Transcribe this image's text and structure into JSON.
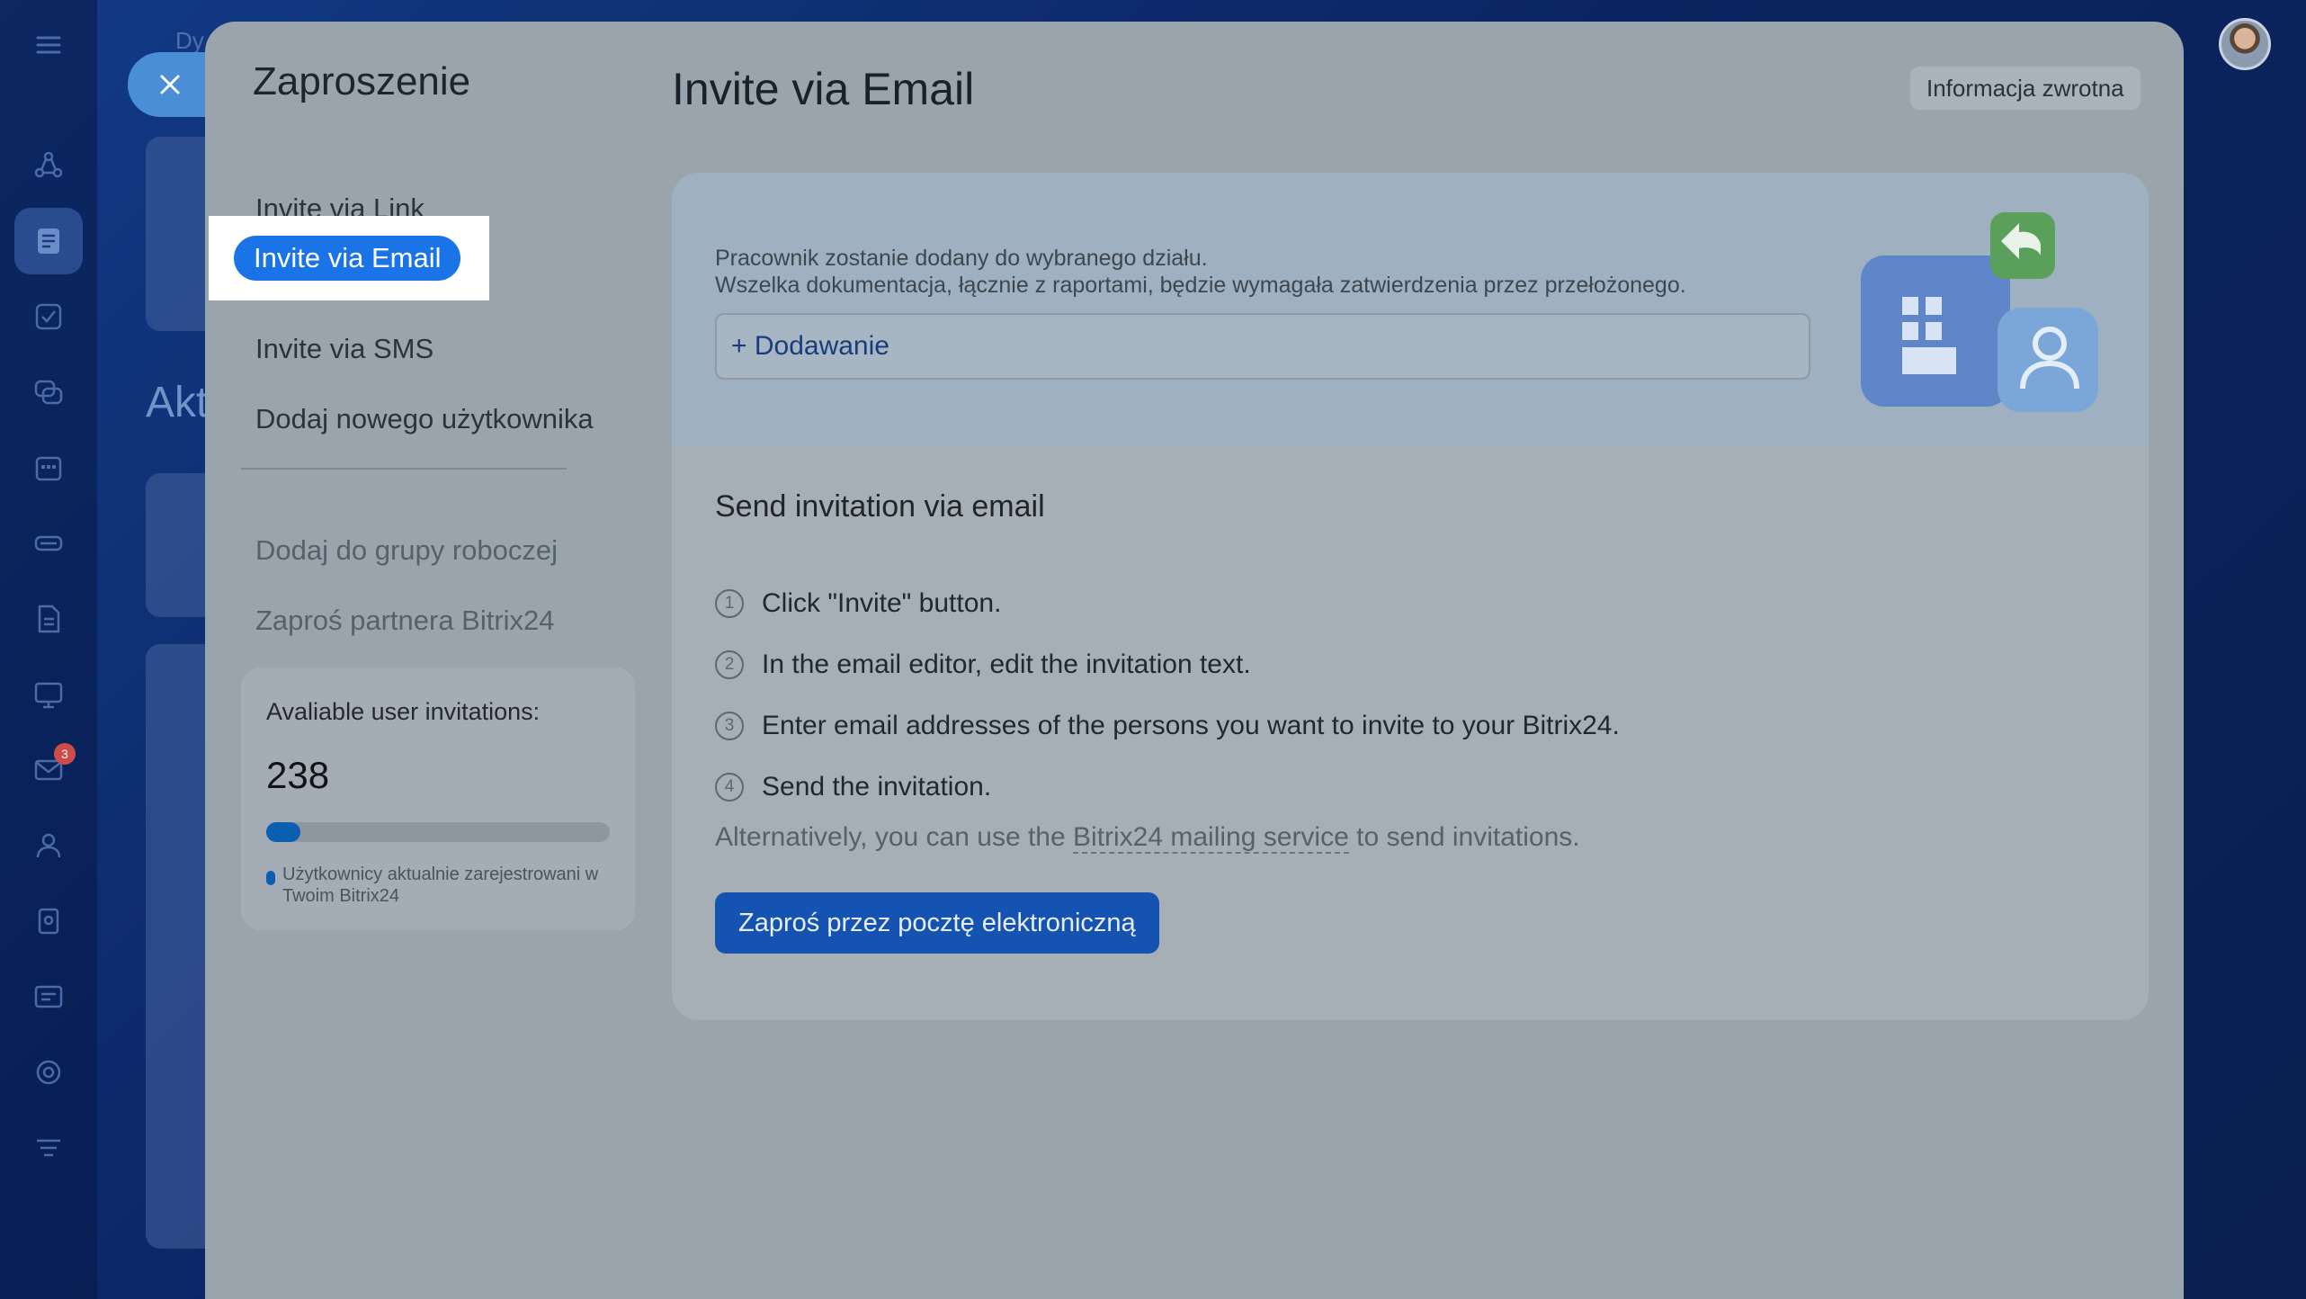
{
  "background": {
    "heading_partial": "Akt",
    "top_partial": "Dy",
    "mail_badge_count": "3"
  },
  "modal": {
    "title": "Zaproszenie",
    "nav": {
      "invite_link": "Invite via Link",
      "invite_email": "Invite via Email",
      "invite_sms": "Invite via SMS",
      "add_user": "Dodaj nowego użytkownika",
      "add_workgroup": "Dodaj do grupy roboczej",
      "invite_partner": "Zaproś partnera Bitrix24"
    },
    "invitations": {
      "label": "Avaliable user invitations:",
      "count": "238",
      "used_fraction": 0.1,
      "legend": "Użytkownicy aktualnie zarejestrowani w Twoim Bitrix24"
    }
  },
  "main": {
    "title": "Invite via Email",
    "feedback_label": "Informacja zwrotna",
    "description_line1": "Pracownik zostanie dodany do wybranego działu.",
    "description_line2": "Wszelka dokumentacja, łącznie z raportami, będzie wymagała zatwierdzenia przez przełożonego.",
    "add_label": "+ Dodawanie",
    "send_title": "Send invitation via email",
    "steps": [
      {
        "num": "1",
        "text": "Click \"Invite\" button."
      },
      {
        "num": "2",
        "text": "In the email editor, edit the invitation text."
      },
      {
        "num": "3",
        "text": "Enter email addresses of the persons you want to invite to your Bitrix24."
      },
      {
        "num": "4",
        "text": "Send the invitation."
      }
    ],
    "alt_prefix": "Alternatively, you can use the",
    "alt_link": "Bitrix24 mailing service",
    "alt_suffix": "to send invitations.",
    "cta_label": "Zaproś przez pocztę elektroniczną"
  },
  "colors": {
    "accent": "#1b73e8",
    "cta": "#1553b2",
    "progress": "#0a5fb0"
  }
}
